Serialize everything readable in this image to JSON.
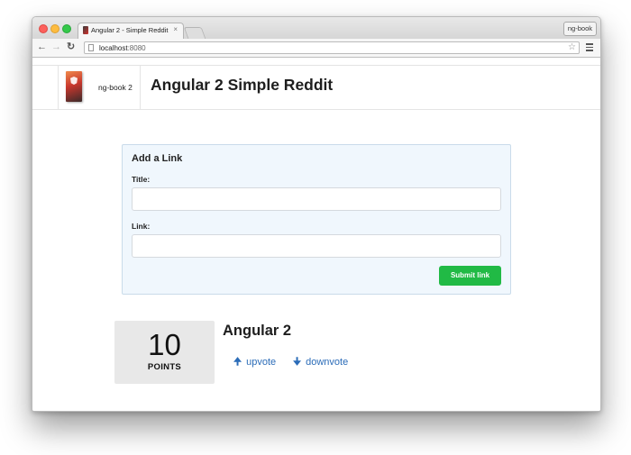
{
  "browser": {
    "tab_title": "Angular 2 - Simple Reddit",
    "tab_close": "×",
    "profile_label": "ng-book",
    "url_host": "localhost",
    "url_port": ":8080"
  },
  "header": {
    "brand": "ng-book 2",
    "title": "Angular 2 Simple Reddit"
  },
  "form": {
    "heading": "Add a Link",
    "title_label": "Title:",
    "title_value": "",
    "link_label": "Link:",
    "link_value": "",
    "submit_label": "Submit link"
  },
  "article": {
    "points": "10",
    "points_label": "POINTS",
    "title": "Angular 2",
    "upvote_label": "upvote",
    "downvote_label": "downvote"
  },
  "colors": {
    "submit_button": "#21ba45",
    "link": "#2b6cb8",
    "form_bg": "#f0f7fd",
    "score_bg": "#e8e8e8"
  },
  "icons": [
    "back-arrow-icon",
    "forward-arrow-icon",
    "reload-icon",
    "page-icon",
    "star-icon",
    "menu-icon",
    "arrow-up-icon",
    "arrow-down-icon",
    "book-icon"
  ]
}
